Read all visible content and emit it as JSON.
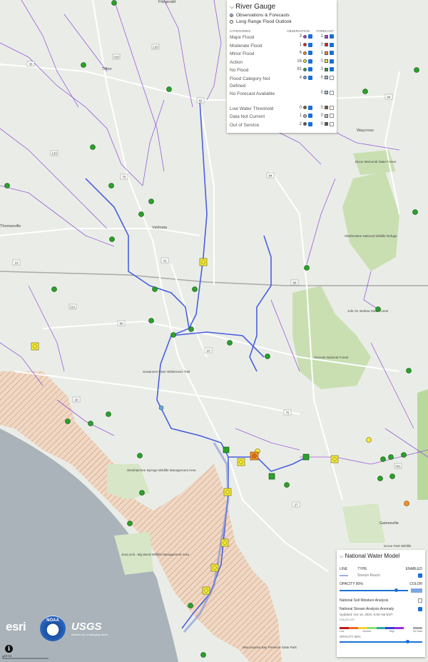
{
  "map": {
    "places": [
      "Fitzgerald",
      "Tifton",
      "Valdosta",
      "Thomasville",
      "Waycross",
      "Dixon Memorial State Forest",
      "Okefenokee National Wildlife Refuge",
      "John M. Bethea State Forest",
      "Osceola National Forest",
      "Suwannee River Wilderness Trail",
      "Steinhatchee Springs Wildlife Management Area",
      "Jena Unit - Big Bend Wildlife Management Area",
      "Gainesville",
      "Grove Park Wildlife",
      "Waccasassa Bay Preserve State Park"
    ],
    "routes": [
      "125",
      "319",
      "82",
      "33",
      "133",
      "75",
      "84",
      "41",
      "221",
      "94",
      "10",
      "90",
      "89",
      "301",
      "20",
      "27",
      "19",
      "75",
      "84",
      "10"
    ],
    "scale_label": "10 mi"
  },
  "river_gauge": {
    "title": "River Gauge",
    "radio_options": [
      {
        "label": "Observations & Forecasts",
        "selected": true
      },
      {
        "label": "Long Range Flood Outlook",
        "selected": false
      }
    ],
    "col_categories": "CATEGORIES",
    "col_observation": "OBSERVATION",
    "col_forecast": "FORECAST",
    "rows": [
      {
        "label": "Major Flood",
        "obs": "3",
        "fc": "1",
        "obs_color": "#b23bd6",
        "fc_color": "#b23bd6",
        "obs_on": true,
        "fc_on": true
      },
      {
        "label": "Moderate Flood",
        "obs": "1",
        "fc": "0",
        "obs_color": "#e52222",
        "fc_color": "#e52222",
        "obs_on": true,
        "fc_on": true
      },
      {
        "label": "Minor Flood",
        "obs": "6",
        "fc": "1",
        "obs_color": "#f39022",
        "fc_color": "#f39022",
        "obs_on": true,
        "fc_on": true
      },
      {
        "label": "Action",
        "obs": "16",
        "fc": "0",
        "obs_color": "#f2e93a",
        "fc_color": "#f2e93a",
        "obs_on": true,
        "fc_on": true
      },
      {
        "label": "No Flood",
        "obs": "81",
        "fc": "3",
        "obs_color": "#2aa12a",
        "fc_color": "#2aa12a",
        "obs_on": true,
        "fc_on": true
      },
      {
        "label": "Flood Category Not Defined",
        "obs": "4",
        "fc": "0",
        "obs_color": "#6ea5d8",
        "fc_color": "#9ac0e4",
        "obs_on": true,
        "fc_on": false
      },
      {
        "label": "No Forecast Available",
        "obs": "",
        "fc": "0",
        "obs_color": "",
        "fc_color": "#9ac0e4",
        "obs_on": false,
        "fc_on": false
      },
      {
        "label": "Low Water Threshold",
        "obs": "0",
        "fc": "0",
        "obs_color": "#8b5a2b",
        "fc_color": "#8b5a2b",
        "obs_on": true,
        "fc_on": false
      },
      {
        "label": "Data Not Current",
        "obs": "1",
        "fc": "0",
        "obs_color": "#bbbbbb",
        "fc_color": "#bbbbbb",
        "obs_on": true,
        "fc_on": false
      },
      {
        "label": "Out of Service",
        "obs": "2",
        "fc": "0",
        "obs_color": "#555555",
        "fc_color": "#555555",
        "obs_on": true,
        "fc_on": false
      }
    ]
  },
  "national_water_model": {
    "title": "National Water Model",
    "col_line": "LINE",
    "col_type": "TYPE",
    "col_enabled": "ENABLED",
    "stream_reach": "Stream Reach",
    "opacity_label": "OPACITY 80%",
    "color_label": "COLOR",
    "soil_moisture": "National Soil Moisture Analysis",
    "stream_anomaly": "National Stream Analysis Anomaly",
    "updated": "Updated: Oct 16, 2024, 6:50 AM EDT",
    "magnitude": "Magnitude",
    "colorbar_labels": [
      "Low",
      "Normal",
      "High",
      "No Data"
    ],
    "opacity_label2": "OPACITY 80%"
  },
  "logos": {
    "esri": "esri",
    "noaa": "NOAA",
    "usgs": "USGS",
    "usgs_tag": "science for a changing world"
  },
  "info_label": "i",
  "colors": {
    "river": "#4a5fe0",
    "stream": "#8a44d8",
    "road": "#ffffff",
    "boundary": "#b0b0b0",
    "gulf": "#a9b3bb",
    "forest": "#c9dfb2",
    "hatch": "#d28a5a"
  }
}
